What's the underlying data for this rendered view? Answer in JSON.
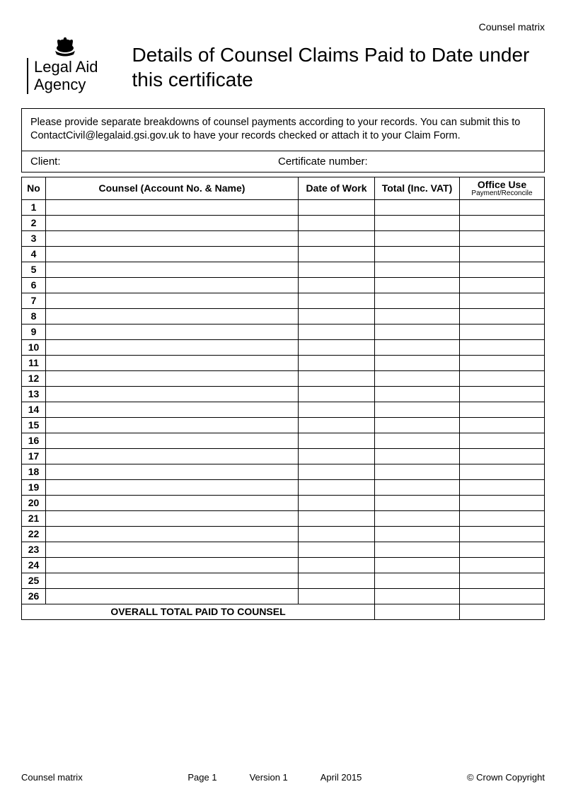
{
  "top_right_label": "Counsel matrix",
  "agency": {
    "line1": "Legal Aid",
    "line2": "Agency"
  },
  "title": "Details of Counsel Claims Paid to Date under this certificate",
  "instructions": "Please provide separate breakdowns of counsel payments according to your records.  You can submit this to ContactCivil@legalaid.gsi.gov.uk to have your records checked or attach it to your Claim Form.",
  "client_label": "Client:",
  "cert_label": "Certificate number:",
  "columns": {
    "no": "No",
    "counsel": "Counsel (Account No. & Name)",
    "date": "Date of Work",
    "total": "Total (Inc. VAT)",
    "office": "Office Use",
    "office_sub": "Payment/Reconcile"
  },
  "rows": [
    {
      "no": "1",
      "counsel": "",
      "date": "",
      "total": "",
      "office": ""
    },
    {
      "no": "2",
      "counsel": "",
      "date": "",
      "total": "",
      "office": ""
    },
    {
      "no": "3",
      "counsel": "",
      "date": "",
      "total": "",
      "office": ""
    },
    {
      "no": "4",
      "counsel": "",
      "date": "",
      "total": "",
      "office": ""
    },
    {
      "no": "5",
      "counsel": "",
      "date": "",
      "total": "",
      "office": ""
    },
    {
      "no": "6",
      "counsel": "",
      "date": "",
      "total": "",
      "office": ""
    },
    {
      "no": "7",
      "counsel": "",
      "date": "",
      "total": "",
      "office": ""
    },
    {
      "no": "8",
      "counsel": "",
      "date": "",
      "total": "",
      "office": ""
    },
    {
      "no": "9",
      "counsel": "",
      "date": "",
      "total": "",
      "office": ""
    },
    {
      "no": "10",
      "counsel": "",
      "date": "",
      "total": "",
      "office": ""
    },
    {
      "no": "11",
      "counsel": "",
      "date": "",
      "total": "",
      "office": ""
    },
    {
      "no": "12",
      "counsel": "",
      "date": "",
      "total": "",
      "office": ""
    },
    {
      "no": "13",
      "counsel": "",
      "date": "",
      "total": "",
      "office": ""
    },
    {
      "no": "14",
      "counsel": "",
      "date": "",
      "total": "",
      "office": ""
    },
    {
      "no": "15",
      "counsel": "",
      "date": "",
      "total": "",
      "office": ""
    },
    {
      "no": "16",
      "counsel": "",
      "date": "",
      "total": "",
      "office": ""
    },
    {
      "no": "17",
      "counsel": "",
      "date": "",
      "total": "",
      "office": ""
    },
    {
      "no": "18",
      "counsel": "",
      "date": "",
      "total": "",
      "office": ""
    },
    {
      "no": "19",
      "counsel": "",
      "date": "",
      "total": "",
      "office": ""
    },
    {
      "no": "20",
      "counsel": "",
      "date": "",
      "total": "",
      "office": ""
    },
    {
      "no": "21",
      "counsel": "",
      "date": "",
      "total": "",
      "office": ""
    },
    {
      "no": "22",
      "counsel": "",
      "date": "",
      "total": "",
      "office": ""
    },
    {
      "no": "23",
      "counsel": "",
      "date": "",
      "total": "",
      "office": ""
    },
    {
      "no": "24",
      "counsel": "",
      "date": "",
      "total": "",
      "office": ""
    },
    {
      "no": "25",
      "counsel": "",
      "date": "",
      "total": "",
      "office": ""
    },
    {
      "no": "26",
      "counsel": "",
      "date": "",
      "total": "",
      "office": ""
    }
  ],
  "total_label": "OVERALL TOTAL PAID TO COUNSEL",
  "footer": {
    "left": "Counsel matrix",
    "page": "Page 1",
    "version": "Version 1",
    "date": "April 2015",
    "copyright": "© Crown Copyright"
  }
}
